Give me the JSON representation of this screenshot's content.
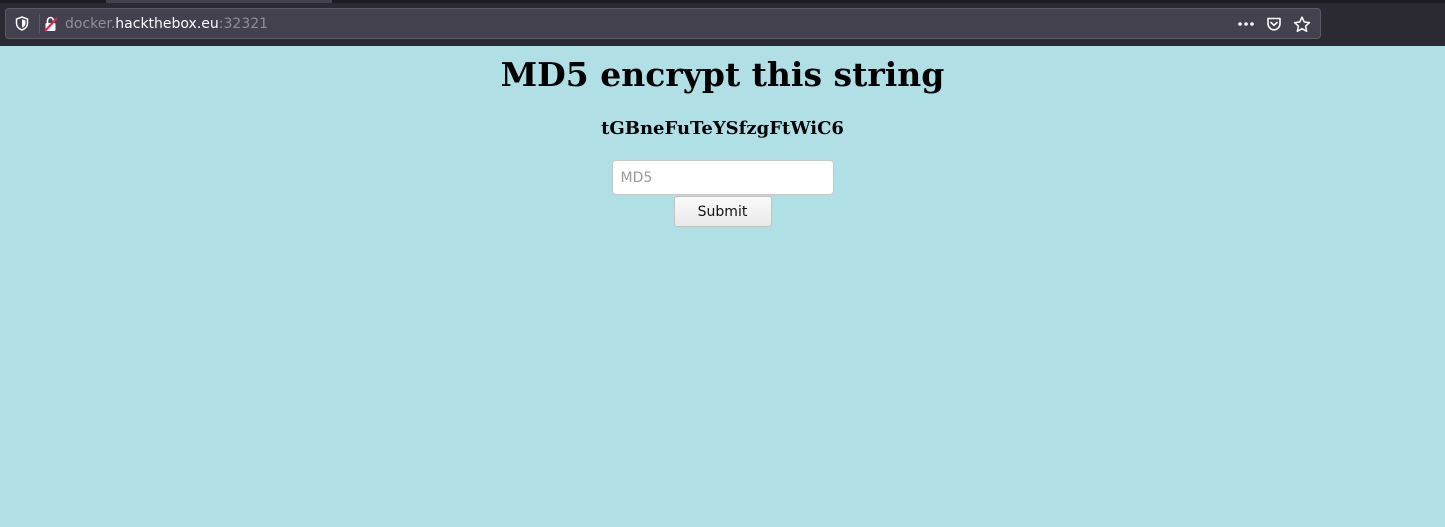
{
  "browser": {
    "url_prefix": "docker.",
    "url_host": "hackthebox.eu",
    "url_port": ":32321",
    "actions_icon": "more-actions-icon",
    "pocket_icon": "pocket-icon",
    "bookmark_icon": "bookmark-star-icon",
    "shield_icon": "tracking-protection-shield-icon",
    "insecure_icon": "insecure-connection-lock-icon"
  },
  "page": {
    "title": "MD5 encrypt this string",
    "challenge_string": "tGBneFuTeYSfzgFtWiC6",
    "input_placeholder": "MD5",
    "input_value": "",
    "submit_label": "Submit",
    "background_color": "#b0e0e6"
  }
}
